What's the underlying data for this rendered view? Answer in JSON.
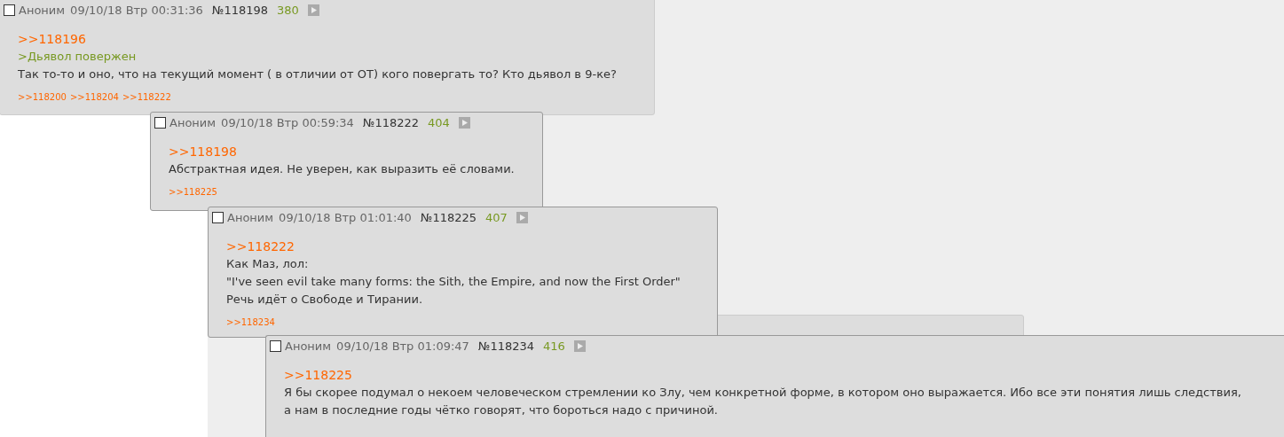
{
  "posts": [
    {
      "author": "Аноним",
      "date": "09/10/18 Втр 00:31:36",
      "number": "№118198",
      "count": "380",
      "selected": false,
      "lines": [
        {
          "kind": "reply",
          "text": ">>118196"
        },
        {
          "kind": "quote",
          "text": ">Дьявол повержен"
        },
        {
          "kind": "text",
          "text": "Так то-то и оно, что на текущий момент ( в отличии от ОТ) кого повергать то? Кто дьявол в 9-ке?"
        }
      ],
      "replies": [
        ">>118200",
        ">>118204",
        ">>118222"
      ]
    },
    {
      "author": "Аноним",
      "date": "09/10/18 Втр 00:59:34",
      "number": "№118222",
      "count": "404",
      "selected": false,
      "lines": [
        {
          "kind": "reply",
          "text": ">>118198"
        },
        {
          "kind": "text",
          "text": "Абстрактная идея. Не уверен, как выразить её словами."
        }
      ],
      "replies": [
        ">>118225"
      ]
    },
    {
      "author": "Аноним",
      "date": "09/10/18 Втр 01:01:40",
      "number": "№118225",
      "count": "407",
      "selected": false,
      "lines": [
        {
          "kind": "reply",
          "text": ">>118222"
        },
        {
          "kind": "text",
          "text": "Как Маз, лол:"
        },
        {
          "kind": "text",
          "text": "\"I've seen evil take many forms: the Sith, the Empire, and now the First Order\""
        },
        {
          "kind": "text",
          "text": "Речь идёт о Свободе и Тирании."
        }
      ],
      "replies": [
        ">>118234"
      ]
    },
    {
      "author": "Аноним",
      "date": "09/10/18 Втр 01:09:47",
      "number": "№118234",
      "count": "416",
      "selected": false,
      "lines": [
        {
          "kind": "reply",
          "text": ">>118225"
        },
        {
          "kind": "text",
          "text": "Я бы скорее подумал о некоем человеческом стремлении ко Злу, чем конкретной форме, в котором оно выражается. Ибо все эти понятия лишь следствия,"
        },
        {
          "kind": "text",
          "text": "а нам в последние годы чётко говорят, что бороться надо с причиной."
        }
      ]
    }
  ]
}
